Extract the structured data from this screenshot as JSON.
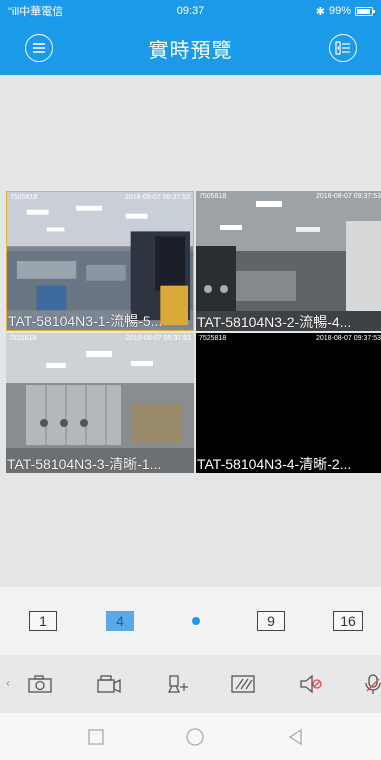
{
  "status_bar": {
    "carrier": "\"ill中華電信",
    "time": "09:37",
    "bluetooth": "✱",
    "battery_pct": "99%"
  },
  "header": {
    "title": "實時預覽",
    "menu_icon": "menu-icon",
    "device_list_icon": "device-list-icon"
  },
  "cameras": [
    {
      "id": "7505818",
      "timestamp": "2018-08-07 09:37:53",
      "label": "TAT-58104N3-1-流暢-5...",
      "selected": true
    },
    {
      "id": "7505818",
      "timestamp": "2018-08-07 09:37:53",
      "label": "TAT-58104N3-2-流暢-4...",
      "selected": false
    },
    {
      "id": "7515818",
      "timestamp": "2018-08-07 09:37:53",
      "label": "TAT-58104N3-3-清晰-1...",
      "selected": false
    },
    {
      "id": "7525818",
      "timestamp": "2018-08-07 09:37:53",
      "label": "TAT-58104N3-4-清晰-2...",
      "selected": false
    }
  ],
  "layouts": {
    "options": [
      "1",
      "4",
      "9",
      "16"
    ],
    "active": "4"
  },
  "toolbar": {
    "tools": [
      "camera-snapshot-icon",
      "record-video-icon",
      "ptz-icon",
      "quality-icon",
      "mute-icon",
      "talk-icon"
    ]
  },
  "navbar": {
    "buttons": [
      "recent-apps-icon",
      "home-icon",
      "back-icon"
    ]
  },
  "colors": {
    "brand": "#1a9ae8",
    "selected_border": "#e0b531",
    "active_layout": "#5aa8e6"
  }
}
